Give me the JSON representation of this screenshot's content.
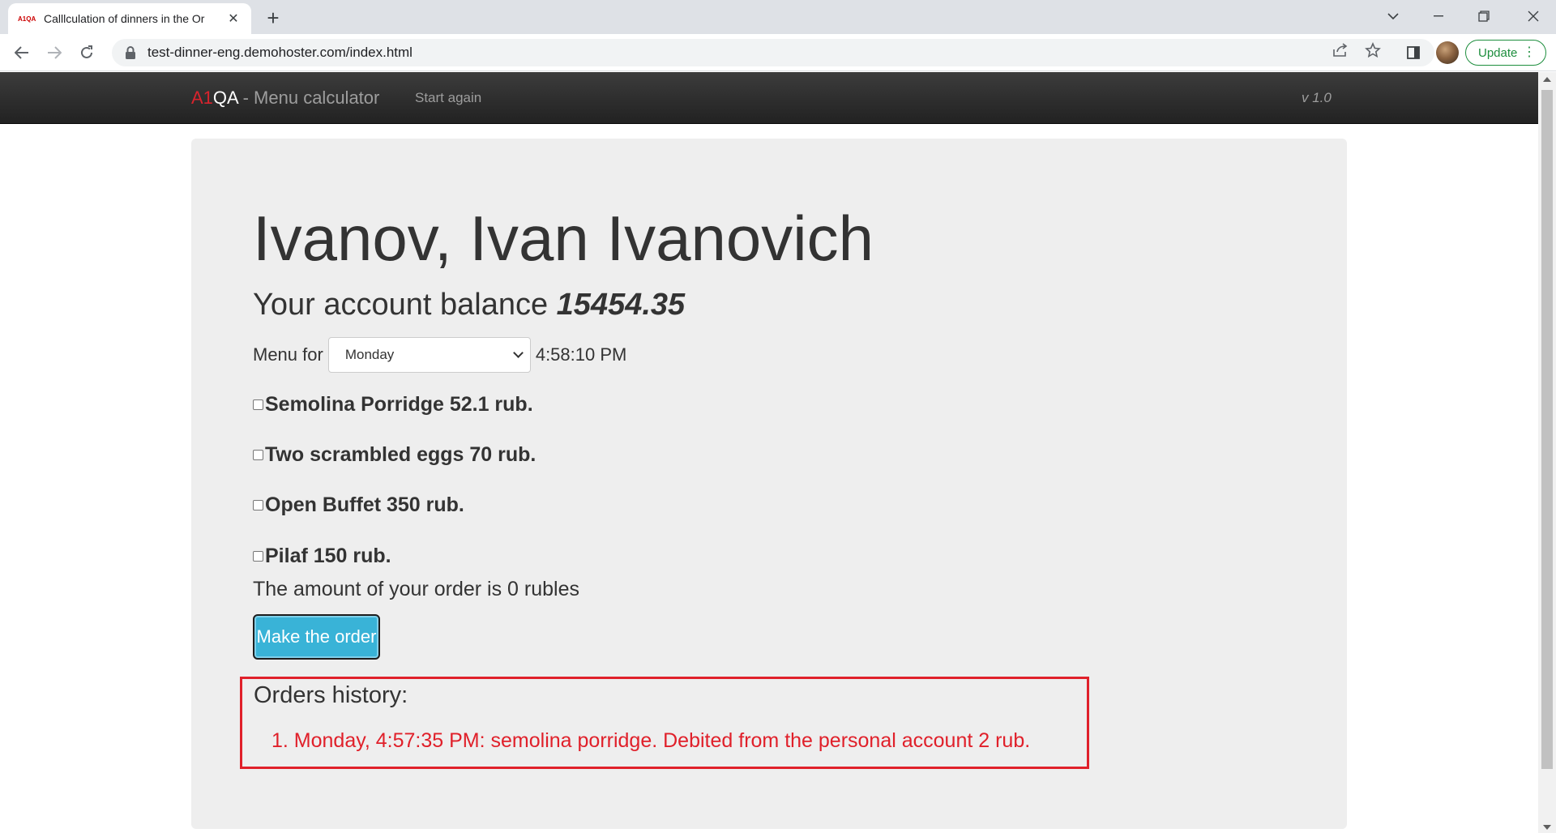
{
  "browser": {
    "tab_title": "Calllculation of dinners in the Or",
    "favicon_text": "A1QA",
    "url": "test-dinner-eng.demohoster.com/index.html",
    "update_label": "Update"
  },
  "nav": {
    "brand_a1": "A1",
    "brand_qa": "QA",
    "brand_rest": " - Menu calculator",
    "start_again": "Start again",
    "version": "v 1.0"
  },
  "user": {
    "name": "Ivanov, Ivan Ivanovich",
    "balance_label": "Your account balance",
    "balance_value": "15454.35"
  },
  "menu": {
    "label": "Menu for",
    "selected_day": "Monday",
    "time": "4:58:10 PM",
    "items": [
      {
        "label": "Semolina Porridge 52.1 rub.",
        "checked": false
      },
      {
        "label": "Two scrambled eggs 70 rub.",
        "checked": false
      },
      {
        "label": "Open Buffet 350 rub.",
        "checked": false
      },
      {
        "label": "Pilaf 150 rub.",
        "checked": false
      }
    ]
  },
  "order": {
    "amount_text": "The amount of your order is 0 rubles",
    "button_label": "Make the order"
  },
  "history": {
    "title": "Orders history:",
    "entries": [
      "1. Monday, 4:57:35 PM: semolina porridge. Debited from the personal account 2 rub."
    ]
  },
  "colors": {
    "accent_red": "#e0202a",
    "button_blue": "#39b3d7",
    "navbar": "#222222"
  }
}
